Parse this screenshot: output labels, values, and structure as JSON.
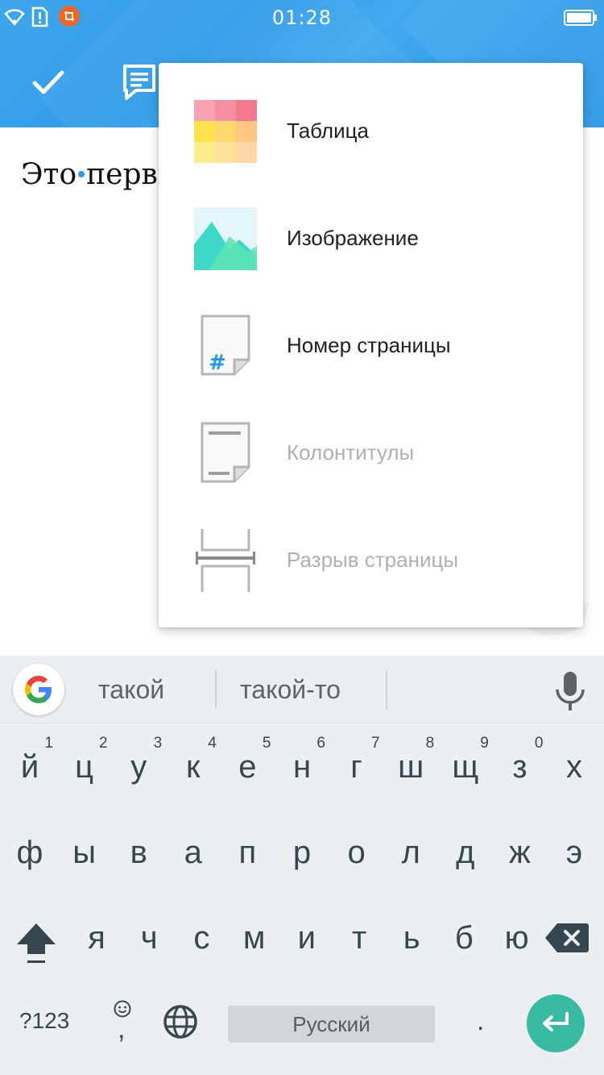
{
  "status_bar": {
    "time": "01:28",
    "icons": [
      "wifi-icon",
      "sim-alert-icon",
      "screenshot-icon",
      "battery-icon"
    ]
  },
  "toolbar": {
    "buttons": [
      "check-icon",
      "text-format-icon"
    ]
  },
  "document": {
    "text_before_cursor": "Это",
    "text_after_cursor": "первы"
  },
  "insert_menu": {
    "items": [
      {
        "label": "Таблица",
        "icon": "table-icon",
        "enabled": true
      },
      {
        "label": "Изображение",
        "icon": "image-icon",
        "enabled": true
      },
      {
        "label": "Номер страницы",
        "icon": "page-number-icon",
        "enabled": true
      },
      {
        "label": "Колонтитулы",
        "icon": "header-footer-icon",
        "enabled": false
      },
      {
        "label": "Разрыв страницы",
        "icon": "page-break-icon",
        "enabled": false
      }
    ]
  },
  "keyboard": {
    "suggestions": [
      "такой",
      "такой-то"
    ],
    "row1": [
      {
        "ch": "й",
        "hint": "1"
      },
      {
        "ch": "ц",
        "hint": "2"
      },
      {
        "ch": "у",
        "hint": "3"
      },
      {
        "ch": "к",
        "hint": "4"
      },
      {
        "ch": "е",
        "hint": "5"
      },
      {
        "ch": "н",
        "hint": "6"
      },
      {
        "ch": "г",
        "hint": "7"
      },
      {
        "ch": "ш",
        "hint": "8"
      },
      {
        "ch": "щ",
        "hint": "9"
      },
      {
        "ch": "з",
        "hint": "0"
      },
      {
        "ch": "х",
        "hint": ""
      }
    ],
    "row2": [
      "ф",
      "ы",
      "в",
      "а",
      "п",
      "р",
      "о",
      "л",
      "д",
      "ж",
      "э"
    ],
    "row3": [
      "я",
      "ч",
      "с",
      "м",
      "и",
      "т",
      "ь",
      "б",
      "ю"
    ],
    "symbols_label": "?123",
    "emoji_comma": ",",
    "space_label": "Русский",
    "period": ".",
    "colors": {
      "background": "#eceff1",
      "enter": "#37b9a2",
      "accent": "#2f9be8"
    }
  }
}
